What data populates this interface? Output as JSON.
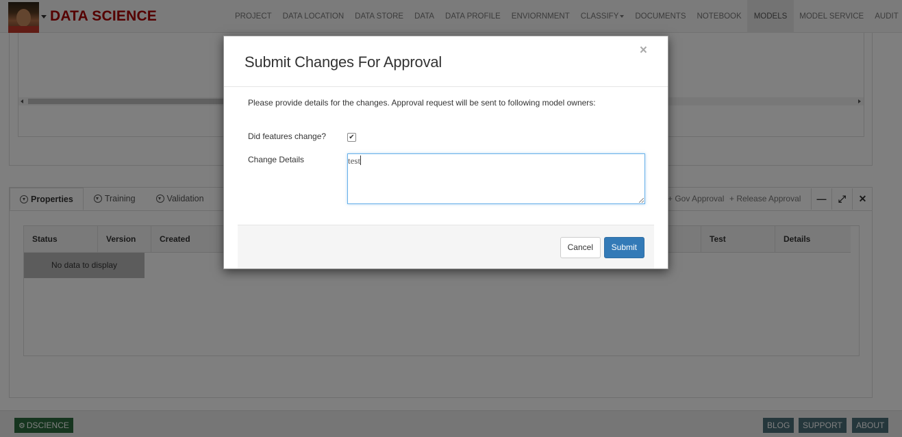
{
  "header": {
    "brand": "DATA SCIENCE",
    "nav": [
      "PROJECT",
      "DATA LOCATION",
      "DATA STORE",
      "DATA",
      "DATA PROFILE",
      "ENVIORNMENT",
      "CLASSIFY",
      "DOCUMENTS",
      "NOTEBOOK",
      "MODELS",
      "MODEL SERVICE",
      "AUDIT"
    ],
    "active_nav": "MODELS"
  },
  "panel": {
    "tabs": [
      "Properties",
      "Training",
      "Validation"
    ],
    "active_tab": "Properties",
    "actions": [
      "Gov Approval",
      "Release Approval"
    ],
    "table": {
      "columns": [
        "Status",
        "Version",
        "Created",
        "Test",
        "Details"
      ],
      "empty_message": "No data to display"
    }
  },
  "modal": {
    "title": "Submit Changes For Approval",
    "close_glyph": "×",
    "description": "Please provide details for the changes. Approval request will be sent to following model owners:",
    "features_label": "Did features change?",
    "features_changed": true,
    "details_label": "Change Details",
    "details_value": "test",
    "cancel_label": "Cancel",
    "submit_label": "Submit"
  },
  "footer": {
    "app_label": "DSCIENCE",
    "links": [
      "BLOG",
      "SUPPORT",
      "ABOUT"
    ]
  },
  "colors": {
    "brand": "#aa0000",
    "primary_button": "#337ab7",
    "footer_green": "#2d6b3e"
  }
}
